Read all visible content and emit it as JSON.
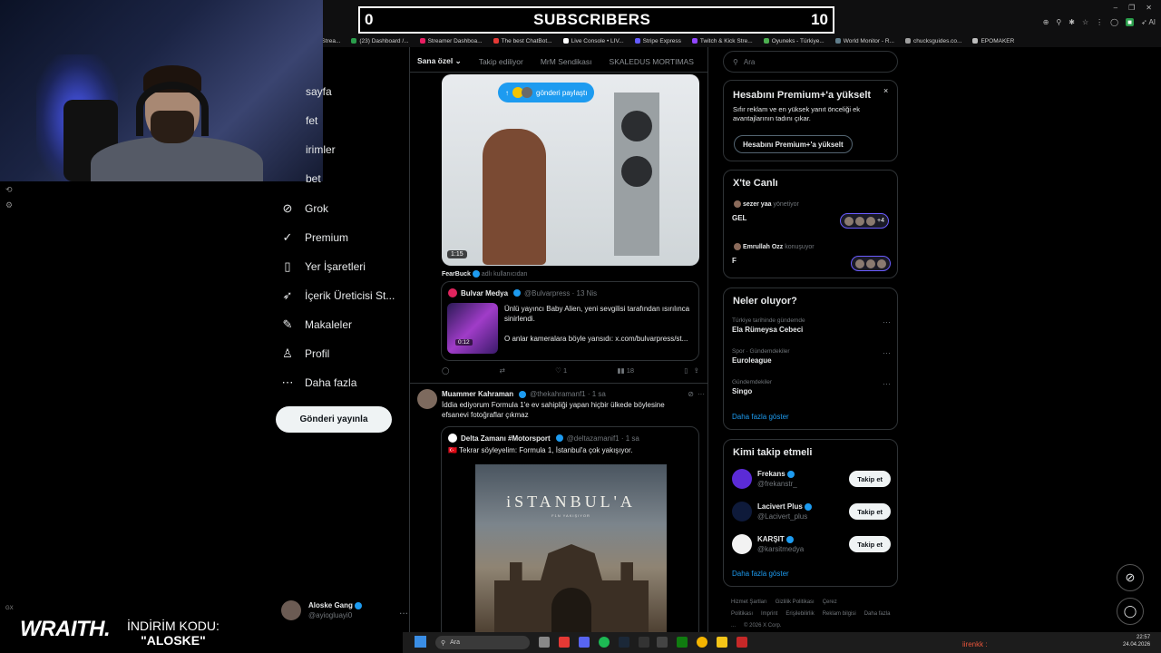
{
  "overlay": {
    "subs_left": "0",
    "subs_title": "SUBSCRIBERS",
    "subs_right": "10",
    "brand": "WRAITH.",
    "discount_label": "İNDİRİM KODU:",
    "discount_code": "\"ALOSKE\""
  },
  "browser": {
    "bookmarks": [
      {
        "label": "g Strea...",
        "color": "#3a3a3a"
      },
      {
        "label": "(23) Dashboard /...",
        "color": "#2a9d4b"
      },
      {
        "label": "Streamer Dashboa...",
        "color": "#e91e63"
      },
      {
        "label": "The best ChatBot...",
        "color": "#e53935"
      },
      {
        "label": "Live Console • LIV...",
        "color": "#ffffff"
      },
      {
        "label": "Stripe Express",
        "color": "#635bff"
      },
      {
        "label": "Twitch & Kick Stre...",
        "color": "#9146ff"
      },
      {
        "label": "Oyuneks - Türkiye...",
        "color": "#4caf50"
      },
      {
        "label": "World Monitor - R...",
        "color": "#607d8b"
      },
      {
        "label": "chucksguides.co...",
        "color": "#9e9e9e"
      },
      {
        "label": "EPOMAKER",
        "color": "#bdbdbd"
      }
    ],
    "ai_label": "AI"
  },
  "nav": {
    "items": [
      {
        "label": "sayfa",
        "icon": "home-icon"
      },
      {
        "label": "fet",
        "icon": "explore-icon"
      },
      {
        "label": "irimler",
        "icon": "notifications-icon"
      },
      {
        "label": "bet",
        "icon": "messages-icon"
      },
      {
        "label": "Grok",
        "icon": "grok-icon"
      },
      {
        "label": "Premium",
        "icon": "premium-icon"
      },
      {
        "label": "Yer İşaretleri",
        "icon": "bookmark-icon"
      },
      {
        "label": "İçerik Üreticisi St...",
        "icon": "rocket-icon"
      },
      {
        "label": "Makaleler",
        "icon": "article-icon"
      },
      {
        "label": "Profil",
        "icon": "profile-icon"
      },
      {
        "label": "Daha fazla",
        "icon": "more-icon"
      }
    ],
    "post_button": "Gönderi yayınla",
    "profile_name": "Aloske Gang",
    "profile_handle": "@ayiogluayi0",
    "more": "..."
  },
  "feed": {
    "tabs": [
      "Sana özel",
      "Takip ediliyor",
      "MrM Sendikası",
      "SKALEDUS MORTIMAS"
    ],
    "share_pill": "gönderi paylaştı",
    "video_time": "1:15",
    "reposter_name": "FearBuck",
    "reposter_meta": "adlı kullanıcıdan",
    "quote1": {
      "name": "Bulvar Medya",
      "handle": "@Bulvarpress · 13 Nis",
      "thumb_time": "0:12",
      "text1": "Ünlü yayıncı Baby Alien, yeni sevgilisi tarafından ısırılınca sinirlendi.",
      "text2": "O anlar kameralara böyle yansıdı: x.com/bulvarpress/st..."
    },
    "actions1": {
      "reply": "",
      "repost": "",
      "like": "1",
      "views": "18"
    },
    "post2": {
      "name": "Muammer Kahraman",
      "handle": "@thekahramanf1 · 1 sa",
      "text": "İddia ediyorum Formula 1'e ev sahipliği yapan hiçbir ülkede böylesine efsanevi fotoğraflar çıkmaz"
    },
    "quote2": {
      "name": "Delta Zamanı #Motorsport",
      "handle": "@deltazamanif1 · 1 sa",
      "text": "🇹🇷 Tekrar söyleyelim: Formula 1, İstanbul'a çok yakışıyor.",
      "image_title": "iSTANBUL'A",
      "image_sub": "F1N YAKIŞIYOR"
    }
  },
  "right": {
    "search_placeholder": "Ara",
    "premium": {
      "title": "Hesabını Premium+'a yükselt",
      "body": "Sıfır reklam ve en yüksek yanıt önceliği ek avantajlarının tadını çıkar.",
      "button": "Hesabını Premium+'a yükselt",
      "close": "×"
    },
    "live": {
      "title": "X'te Canlı",
      "rows": [
        {
          "host": "sezer yaa",
          "role": "yönetiyor",
          "title": "GEL",
          "extra": "+4"
        },
        {
          "host": "Emrullah Ozz",
          "role": "konuşuyor",
          "title": "F",
          "extra": ""
        }
      ]
    },
    "trends": {
      "title": "Neler oluyor?",
      "items": [
        {
          "meta": "Türkiye tarihinde gündemde",
          "name": "Ela Rümeysa Cebeci"
        },
        {
          "meta": "Spor · Gündemdekiler",
          "name": "Euroleague"
        },
        {
          "meta": "Gündemdekiler",
          "name": "Singo"
        }
      ],
      "more": "Daha fazla göster"
    },
    "follow": {
      "title": "Kimi takip etmeli",
      "items": [
        {
          "name": "Frekans",
          "handle": "@frekanstr_",
          "button": "Takip et",
          "color": "#5b2bd6"
        },
        {
          "name": "Lacivert Plus",
          "handle": "@Lacivert_plus",
          "button": "Takip et",
          "color": "#0e1a3a"
        },
        {
          "name": "KARŞIT",
          "handle": "@karsitmedya",
          "button": "Takip et",
          "color": "#f2f2f2"
        }
      ],
      "more": "Daha fazla göster"
    },
    "footer": [
      "Hizmet Şartları",
      "Gizlilik Politikası",
      "Çerez Politikası",
      "Imprint",
      "Erişilebilirlik",
      "Reklam bilgisi",
      "Daha fazla ...",
      "© 2026 X Corp."
    ]
  },
  "taskbar": {
    "search": "Ara",
    "user": "iirenkk :",
    "time": "22:57",
    "date": "24.04.2026"
  }
}
